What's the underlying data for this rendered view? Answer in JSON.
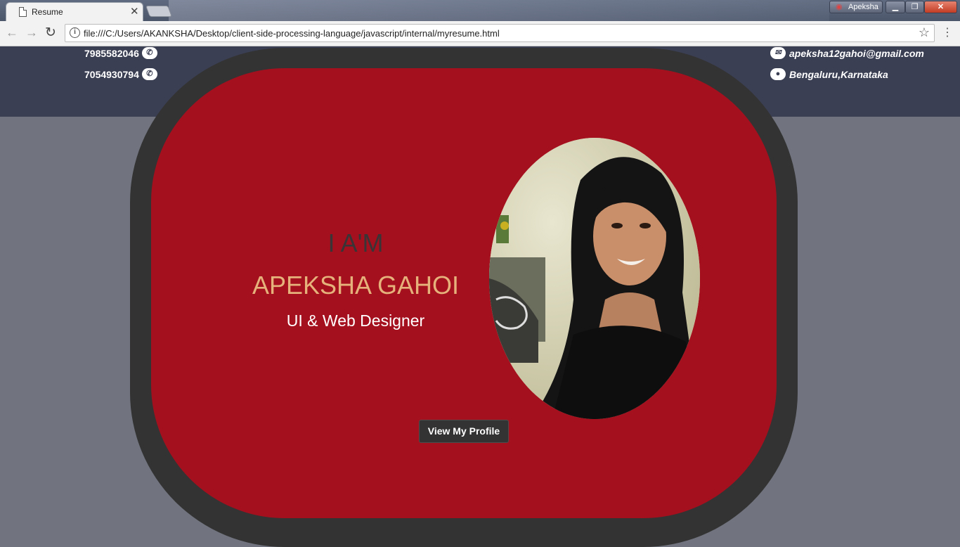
{
  "browser": {
    "tab_title": "Resume",
    "tab_close": "✕",
    "profile_name": "Apeksha",
    "url": "file:///C:/Users/AKANKSHA/Desktop/client-side-processing-language/javascript/internal/myresume.html"
  },
  "contact": {
    "phone": "7985582046",
    "whatsapp": "7054930794",
    "email": "apeksha12gahoi@gmail.com",
    "location": "Bengaluru,Karnataka"
  },
  "hero": {
    "intro": "I A'M",
    "name": "APEKSHA GAHOI",
    "role": "UI & Web Designer",
    "button_label": "View My Profile"
  },
  "colors": {
    "header_bg": "#3b3f54",
    "page_bg": "#71747e",
    "frame": "#333333",
    "card": "#a5101e",
    "name_accent": "#e6b27c"
  },
  "icons": [
    "file-icon",
    "close-icon",
    "back-arrow-icon",
    "forward-arrow-icon",
    "reload-icon",
    "info-icon",
    "star-icon",
    "menu-icon",
    "phone-icon",
    "whatsapp-icon",
    "envelope-icon",
    "location-pin-icon"
  ]
}
